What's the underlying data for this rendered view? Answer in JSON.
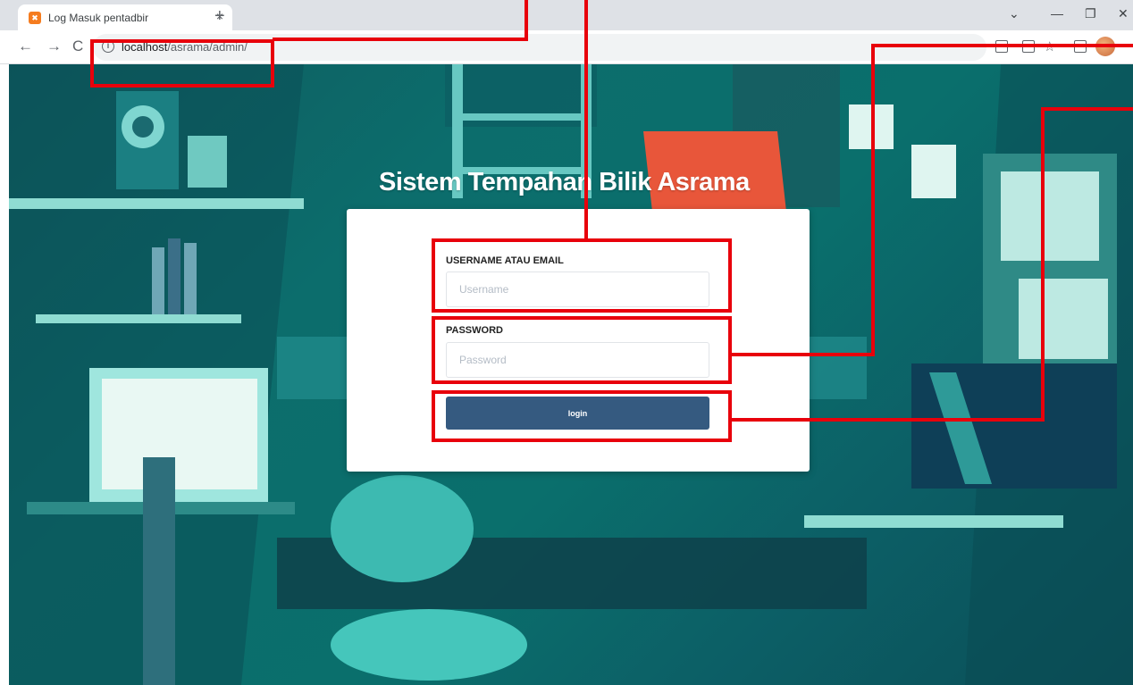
{
  "browser": {
    "tab_title": "Log Masuk pentadbir",
    "tab_close": "×",
    "new_tab": "+",
    "url_host": "localhost",
    "url_path": "/asrama/admin/",
    "window_controls": [
      "⌄",
      "—",
      "❐",
      "✕"
    ],
    "nav": {
      "back": "←",
      "forward": "→",
      "reload": "C"
    }
  },
  "page": {
    "title": "Sistem Tempahan Bilik Asrama"
  },
  "form": {
    "username_label": "USERNAME ATAU EMAIL",
    "username_placeholder": "Username",
    "username_value": "",
    "password_label": "PASSWORD",
    "password_placeholder": "Password",
    "password_value": "",
    "login_label": "login"
  },
  "colors": {
    "annotation": "#e8000b",
    "button": "#355a80",
    "background": "#0c6d6c"
  },
  "icons": [
    "info-icon",
    "back-arrow-icon",
    "forward-arrow-icon",
    "reload-icon",
    "favicon-icon",
    "star-icon",
    "share-icon",
    "extension-icon",
    "profile-avatar"
  ]
}
